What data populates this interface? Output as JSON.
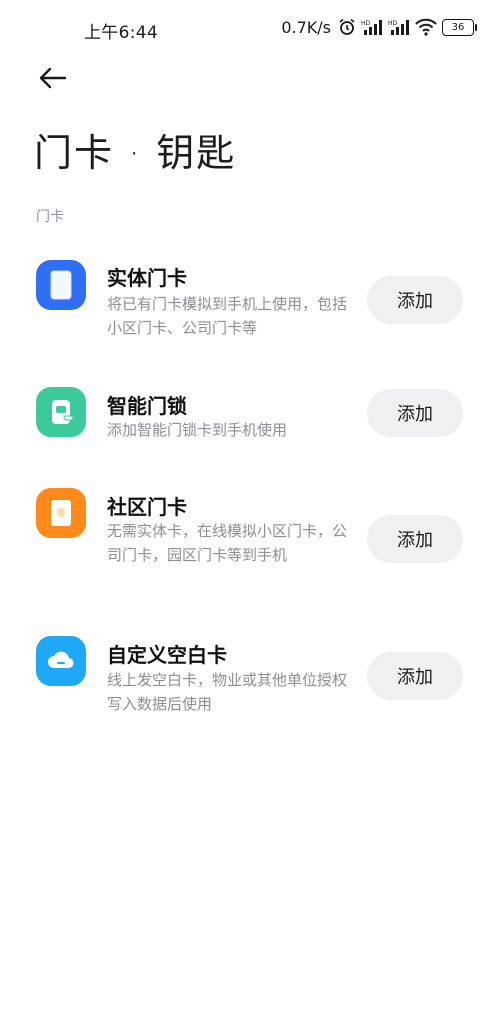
{
  "status_bar": {
    "time": "上午6:44",
    "net_speed": "0.7K/s",
    "battery": "36"
  },
  "header": {
    "back_icon": "arrow-left-icon",
    "title": "门卡 · 钥匙"
  },
  "section": {
    "label": "门卡"
  },
  "items": [
    {
      "title": "实体门卡",
      "desc": "将已有门卡模拟到手机上使用，包括小区门卡、公司门卡等",
      "button": "添加",
      "icon": "physical-card-icon",
      "color": "#2f6ff5"
    },
    {
      "title": "智能门锁",
      "desc": "添加智能门锁卡到手机使用",
      "button": "添加",
      "icon": "smart-lock-icon",
      "color": "#3cc99b"
    },
    {
      "title": "社区门卡",
      "desc": "无需实体卡，在线模拟小区门卡，公司门卡，园区门卡等到手机",
      "button": "添加",
      "icon": "community-card-icon",
      "color": "#ff8a1a"
    },
    {
      "title": "自定义空白卡",
      "desc": "线上发空白卡，物业或其他单位授权写入数据后使用",
      "button": "添加",
      "icon": "blank-card-icon",
      "color": "#1fa8f5"
    }
  ]
}
